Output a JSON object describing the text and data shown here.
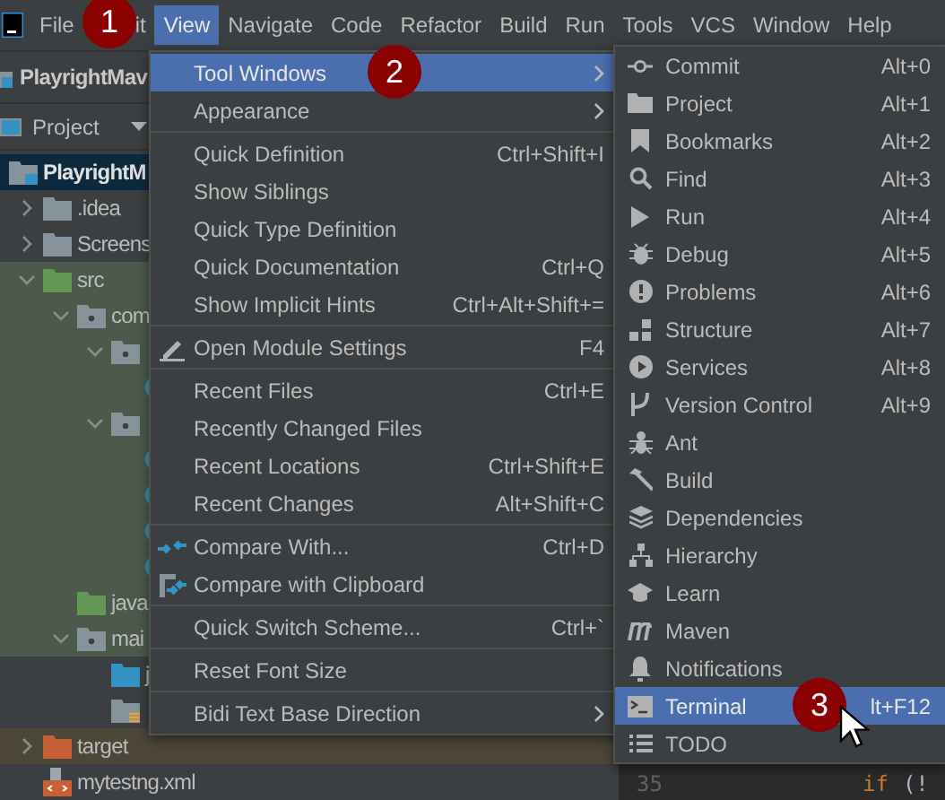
{
  "menu_bar": [
    {
      "label": "File",
      "selected": false
    },
    {
      "label": "it",
      "selected": false
    },
    {
      "label": "View",
      "selected": true
    },
    {
      "label": "Navigate",
      "selected": false
    },
    {
      "label": "Code",
      "selected": false
    },
    {
      "label": "Refactor",
      "selected": false
    },
    {
      "label": "Build",
      "selected": false
    },
    {
      "label": "Run",
      "selected": false
    },
    {
      "label": "Tools",
      "selected": false
    },
    {
      "label": "VCS",
      "selected": false
    },
    {
      "label": "Window",
      "selected": false
    },
    {
      "label": "Help",
      "selected": false
    }
  ],
  "navigation_bar": {
    "project": "PlayrightMav"
  },
  "project_panel": {
    "title": "Project"
  },
  "project_tree": [
    {
      "label": "PlayrightM",
      "kind": "module",
      "selected": true,
      "expanded": true,
      "children": [
        {
          "label": ".idea",
          "kind": "folder",
          "selected": false,
          "expanded": false
        },
        {
          "label": "Screens",
          "kind": "folder",
          "selected": false,
          "expanded": false
        },
        {
          "label": "src",
          "kind": "source",
          "selected": false,
          "expanded": true,
          "children": [
            {
              "label": "com",
              "kind": "package",
              "selected": false,
              "expanded": true,
              "children": [
                {
                  "kind": "package",
                  "selected": false,
                  "expanded": true,
                  "children": [
                    {
                      "kind": "class",
                      "selected": false
                    }
                  ]
                },
                {
                  "kind": "package",
                  "selected": false,
                  "expanded": true,
                  "children": [
                    {
                      "kind": "class",
                      "selected": false
                    },
                    {
                      "kind": "class",
                      "selected": false
                    },
                    {
                      "kind": "class",
                      "selected": false
                    },
                    {
                      "kind": "class",
                      "selected": false
                    }
                  ]
                }
              ]
            },
            {
              "label": "java",
              "kind": "source",
              "selected": false
            },
            {
              "label": "mai",
              "kind": "package",
              "selected": false,
              "expanded": true,
              "children": [
                {
                  "label": "j",
                  "kind": "test-folder",
                  "selected": false
                },
                {
                  "kind": "resources",
                  "selected": false
                }
              ]
            }
          ]
        },
        {
          "label": "target",
          "kind": "excluded",
          "selected": false,
          "expanded": false
        },
        {
          "label": "mytestng.xml",
          "kind": "xml",
          "selected": false
        }
      ]
    }
  ],
  "view_menu": [
    [
      {
        "label": "Tool Windows",
        "submenu": true,
        "selected": true
      },
      {
        "label": "Appearance",
        "submenu": true,
        "selected": false
      }
    ],
    [
      {
        "label": "Quick Definition",
        "shortcut": "Ctrl+Shift+I",
        "selected": false
      },
      {
        "label": "Show Siblings",
        "selected": false
      },
      {
        "label": "Quick Type Definition",
        "selected": false
      },
      {
        "label": "Quick Documentation",
        "shortcut": "Ctrl+Q",
        "selected": false
      },
      {
        "label": "Show Implicit Hints",
        "shortcut": "Ctrl+Alt+Shift+=",
        "selected": false
      }
    ],
    [
      {
        "label": "Open Module Settings",
        "shortcut": "F4",
        "kind": "pencil",
        "selected": false
      }
    ],
    [
      {
        "label": "Recent Files",
        "shortcut": "Ctrl+E",
        "selected": false
      },
      {
        "label": "Recently Changed Files",
        "selected": false
      },
      {
        "label": "Recent Locations",
        "shortcut": "Ctrl+Shift+E",
        "selected": false
      },
      {
        "label": "Recent Changes",
        "shortcut": "Alt+Shift+C",
        "selected": false
      }
    ],
    [
      {
        "label": "Compare With...",
        "shortcut": "Ctrl+D",
        "kind": "compare",
        "selected": false
      },
      {
        "label": "Compare with Clipboard",
        "kind": "clipboard",
        "selected": false
      }
    ],
    [
      {
        "label": "Quick Switch Scheme...",
        "shortcut": "Ctrl+`",
        "selected": false
      }
    ],
    [
      {
        "label": "Reset Font Size",
        "selected": false
      }
    ],
    [
      {
        "label": "Bidi Text Base Direction",
        "submenu": true,
        "selected": false
      }
    ]
  ],
  "tool_windows_menu": [
    {
      "label": "Commit",
      "shortcut": "Alt+0",
      "kind": "commit",
      "selected": false
    },
    {
      "label": "Project",
      "shortcut": "Alt+1",
      "kind": "folder",
      "selected": false
    },
    {
      "label": "Bookmarks",
      "shortcut": "Alt+2",
      "kind": "bookmark",
      "selected": false
    },
    {
      "label": "Find",
      "shortcut": "Alt+3",
      "kind": "search",
      "selected": false
    },
    {
      "label": "Run",
      "shortcut": "Alt+4",
      "kind": "run",
      "selected": false
    },
    {
      "label": "Debug",
      "shortcut": "Alt+5",
      "kind": "bug",
      "selected": false
    },
    {
      "label": "Problems",
      "shortcut": "Alt+6",
      "kind": "problems",
      "selected": false
    },
    {
      "label": "Structure",
      "shortcut": "Alt+7",
      "kind": "structure",
      "selected": false
    },
    {
      "label": "Services",
      "shortcut": "Alt+8",
      "kind": "services",
      "selected": false
    },
    {
      "label": "Version Control",
      "shortcut": "Alt+9",
      "kind": "branch",
      "selected": false
    },
    {
      "label": "Ant",
      "kind": "ant",
      "selected": false
    },
    {
      "label": "Build",
      "kind": "hammer",
      "selected": false
    },
    {
      "label": "Dependencies",
      "kind": "layers",
      "selected": false
    },
    {
      "label": "Hierarchy",
      "kind": "hierarchy",
      "selected": false
    },
    {
      "label": "Learn",
      "kind": "cap",
      "selected": false
    },
    {
      "label": "Maven",
      "kind": "maven",
      "selected": false
    },
    {
      "label": "Notifications",
      "kind": "bell",
      "selected": false
    },
    {
      "label": "Terminal",
      "shortcut": "lt+F12",
      "kind": "terminal",
      "selected": true
    },
    {
      "label": "TODO",
      "kind": "list",
      "selected": false
    }
  ],
  "editor": {
    "line_number": "35",
    "keyword": "if",
    "code": "(!"
  },
  "step_badges": [
    "1",
    "2",
    "3"
  ]
}
